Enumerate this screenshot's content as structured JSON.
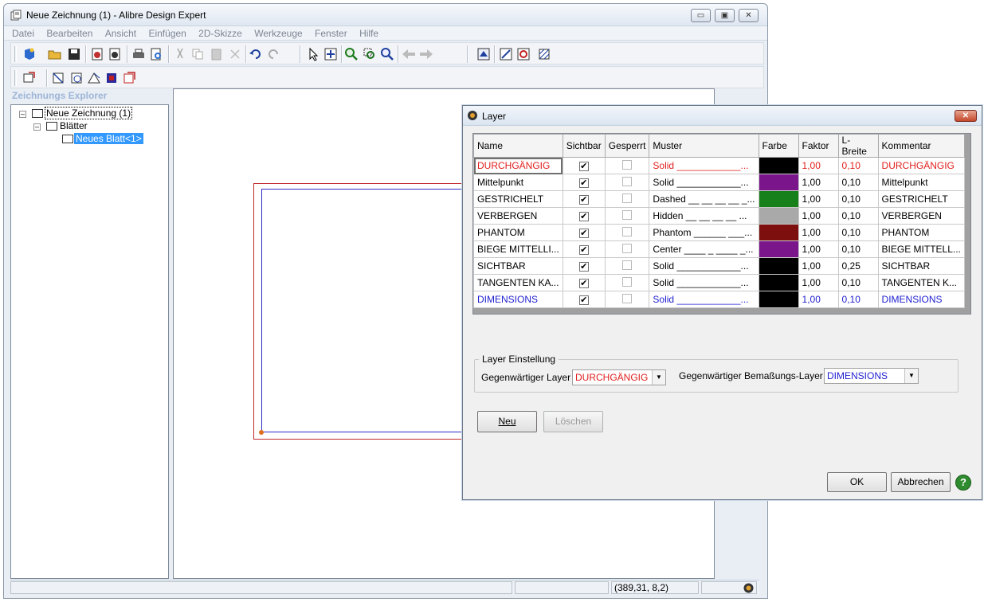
{
  "window": {
    "title": "Neue Zeichnung (1) - Alibre Design Expert",
    "controls": {
      "minimize": "▭",
      "maximize": "▣",
      "close": "✕"
    }
  },
  "menu": [
    "Datei",
    "Bearbeiten",
    "Ansicht",
    "Einfügen",
    "2D-Skizze",
    "Werkzeuge",
    "Fenster",
    "Hilfe"
  ],
  "explorer": {
    "title": "Zeichnungs Explorer",
    "tree": {
      "root": "Neue Zeichnung (1)",
      "folder": "Blätter",
      "sheet": "Neues Blatt<1>"
    }
  },
  "statusbar": {
    "coords": "(389,31, 8,2)"
  },
  "dialog": {
    "title": "Layer",
    "close_label": "✕",
    "columns": [
      "Name",
      "Sichtbar",
      "Gesperrt",
      "Muster",
      "Farbe",
      "Faktor",
      "L-Breite",
      "Kommentar"
    ],
    "rows": [
      {
        "name": "DURCHGÄNGIG",
        "visible": "✔",
        "muster": "Solid ____________...",
        "color": "#000000",
        "faktor": "1,00",
        "breite": "0,10",
        "kommentar": "DURCHGÄNGIG",
        "textcolor": "#e0201e"
      },
      {
        "name": "Mittelpunkt",
        "visible": "✔",
        "muster": "Solid ____________...",
        "color": "#7b158c",
        "faktor": "1,00",
        "breite": "0,10",
        "kommentar": "Mittelpunkt",
        "textcolor": "#000000"
      },
      {
        "name": "GESTRICHELT",
        "visible": "✔",
        "muster": "Dashed __ __ __ __ _...",
        "color": "#17801a",
        "faktor": "1,00",
        "breite": "0,10",
        "kommentar": "GESTRICHELT",
        "textcolor": "#000000"
      },
      {
        "name": "VERBERGEN",
        "visible": "✔",
        "muster": "Hidden __ __ __ __ ...",
        "color": "#a9a9a9",
        "faktor": "1,00",
        "breite": "0,10",
        "kommentar": "VERBERGEN",
        "textcolor": "#000000"
      },
      {
        "name": "PHANTOM",
        "visible": "✔",
        "muster": "Phantom ______ ___...",
        "color": "#7d0f0f",
        "faktor": "1,00",
        "breite": "0,10",
        "kommentar": "PHANTOM",
        "textcolor": "#000000"
      },
      {
        "name": "BIEGE MITTELLI...",
        "visible": "✔",
        "muster": "Center ____ _ ____ _...",
        "color": "#7b158c",
        "faktor": "1,00",
        "breite": "0,10",
        "kommentar": "BIEGE MITTELL...",
        "textcolor": "#000000"
      },
      {
        "name": "SICHTBAR",
        "visible": "✔",
        "muster": "Solid ____________...",
        "color": "#000000",
        "faktor": "1,00",
        "breite": "0,25",
        "kommentar": "SICHTBAR",
        "textcolor": "#000000"
      },
      {
        "name": "TANGENTEN KA...",
        "visible": "✔",
        "muster": "Solid ____________...",
        "color": "#000000",
        "faktor": "1,00",
        "breite": "0,10",
        "kommentar": "TANGENTEN K...",
        "textcolor": "#000000"
      },
      {
        "name": "DIMENSIONS",
        "visible": "✔",
        "muster": "Solid ____________...",
        "color": "#000000",
        "faktor": "1,00",
        "breite": "0,10",
        "kommentar": "DIMENSIONS",
        "textcolor": "#1e1ed0"
      }
    ],
    "group_label": "Layer Einstellung",
    "current_layer_label": "Gegenwärtiger Layer",
    "current_layer_value": "DURCHGÄNGIG",
    "current_dim_layer_label": "Gegenwärtiger Bemaßungs-Layer",
    "current_dim_layer_value": "DIMENSIONS",
    "buttons": {
      "new": "Neu",
      "delete": "Löschen",
      "ok": "OK",
      "cancel": "Abbrechen",
      "help": "?"
    },
    "colors": {
      "red_text": "#e0201e",
      "blue_text": "#1e1ed0"
    }
  }
}
